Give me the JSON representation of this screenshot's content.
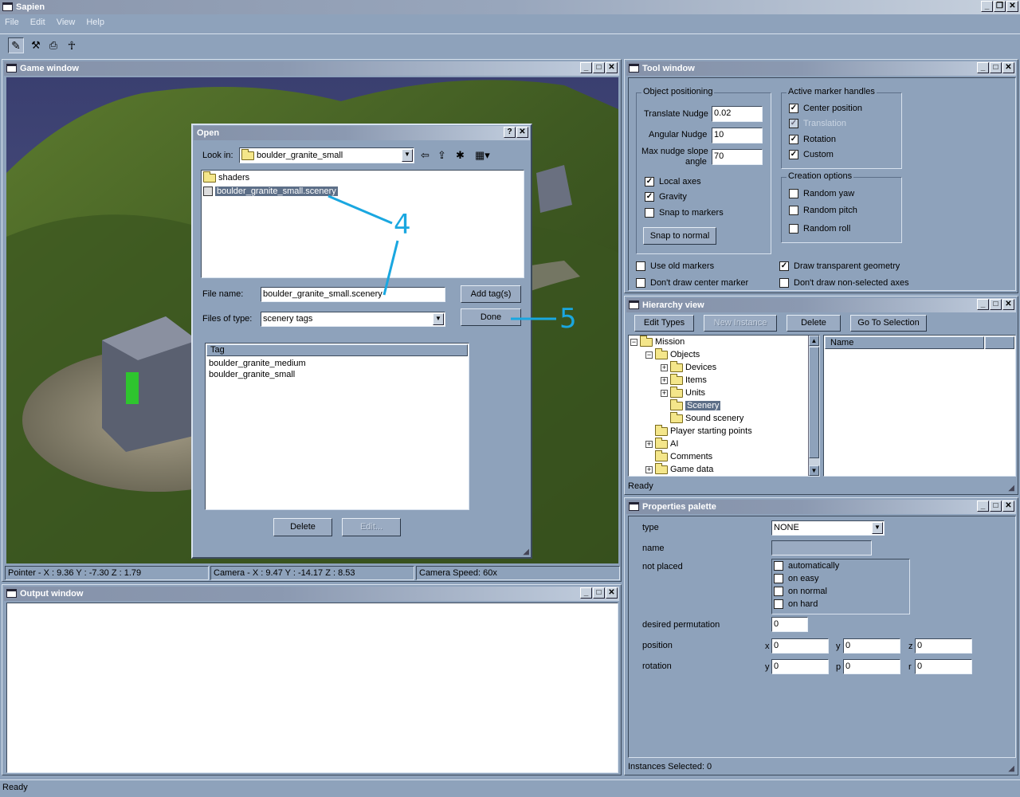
{
  "app": {
    "title": "Sapien",
    "menu": [
      "File",
      "Edit",
      "View",
      "Help"
    ],
    "status": "Ready"
  },
  "game_window": {
    "title": "Game window",
    "status": {
      "pointer": "Pointer - X : 9.36  Y : -7.30  Z : 1.79",
      "camera": "Camera - X : 9.47  Y : -14.17  Z : 8.53",
      "speed": "Camera Speed: 60x"
    }
  },
  "open_dialog": {
    "title": "Open",
    "look_in_label": "Look in:",
    "look_in_value": "boulder_granite_small",
    "files": [
      "shaders",
      "boulder_granite_small.scenery"
    ],
    "file_name_label": "File name:",
    "file_name_value": "boulder_granite_small.scenery",
    "files_of_type_label": "Files of type:",
    "files_of_type_value": "scenery tags",
    "add_tags_label": "Add tag(s)",
    "done_label": "Done",
    "tag_column": "Tag",
    "tags": [
      "boulder_granite_medium",
      "boulder_granite_small"
    ],
    "delete_label": "Delete",
    "edit_label": "Edit..."
  },
  "annotations": {
    "step4": "4",
    "step5": "5",
    "color": "#1aa7e0"
  },
  "output_window": {
    "title": "Output window"
  },
  "tool_window": {
    "title": "Tool window",
    "object_positioning": {
      "title": "Object positioning",
      "translate_label": "Translate Nudge",
      "translate_value": "0.02",
      "angular_label": "Angular Nudge",
      "angular_value": "10",
      "slope_label_1": "Max nudge slope",
      "slope_label_2": "angle",
      "slope_value": "70",
      "local_axes": "Local axes",
      "gravity": "Gravity",
      "snap_markers": "Snap to markers",
      "snap_normal": "Snap to normal"
    },
    "marker_handles": {
      "title": "Active marker handles",
      "center": "Center position",
      "translation": "Translation",
      "rotation": "Rotation",
      "custom": "Custom"
    },
    "creation": {
      "title": "Creation options",
      "yaw": "Random yaw",
      "pitch": "Random pitch",
      "roll": "Random roll"
    },
    "use_old_markers": "Use old markers",
    "dont_draw_center": "Don't draw center marker",
    "draw_transparent": "Draw transparent geometry",
    "dont_draw_axes": "Don't draw non-selected axes"
  },
  "hierarchy": {
    "title": "Hierarchy view",
    "edit_types": "Edit Types",
    "new_instance": "New Instance",
    "delete": "Delete",
    "go_to_selection": "Go To Selection",
    "tree": [
      "Mission",
      "Objects",
      "Devices",
      "Items",
      "Units",
      "Scenery",
      "Sound scenery",
      "Player starting points",
      "AI",
      "Comments",
      "Game data"
    ],
    "name_column": "Name",
    "status": "Ready"
  },
  "properties": {
    "title": "Properties palette",
    "type_label": "type",
    "type_value": "NONE",
    "name_label": "name",
    "not_placed_label": "not placed",
    "not_placed_options": [
      "automatically",
      "on easy",
      "on normal",
      "on hard"
    ],
    "permutation_label": "desired permutation",
    "permutation_value": "0",
    "position_label": "position",
    "rotation_label": "rotation",
    "pos": {
      "x_label": "x",
      "x": "0",
      "y_label": "y",
      "y": "0",
      "z_label": "z",
      "z": "0"
    },
    "rot": {
      "y_label": "y",
      "y": "0",
      "p_label": "p",
      "p": "0",
      "r_label": "r",
      "r": "0"
    },
    "status": "Instances Selected: 0"
  }
}
